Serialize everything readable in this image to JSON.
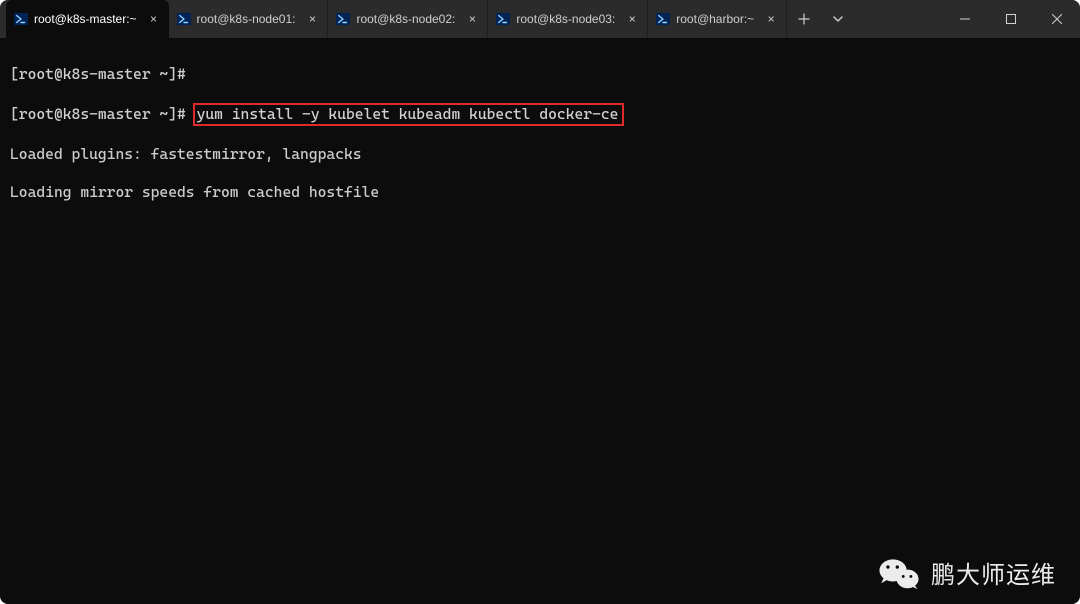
{
  "tabs": [
    {
      "label": "root@k8s-master:~",
      "active": true
    },
    {
      "label": "root@k8s-node01:",
      "active": false
    },
    {
      "label": "root@k8s-node02:",
      "active": false
    },
    {
      "label": "root@k8s-node03:",
      "active": false
    },
    {
      "label": "root@harbor:~",
      "active": false
    }
  ],
  "terminal": {
    "prompt": "[root@k8s-master ~]#",
    "command": "yum install -y kubelet kubeadm kubectl docker-ce",
    "output": [
      "Loaded plugins: fastestmirror, langpacks",
      "Loading mirror speeds from cached hostfile"
    ]
  },
  "watermark": {
    "text": "鹏大师运维"
  },
  "icons": {
    "close_glyph": "×"
  }
}
